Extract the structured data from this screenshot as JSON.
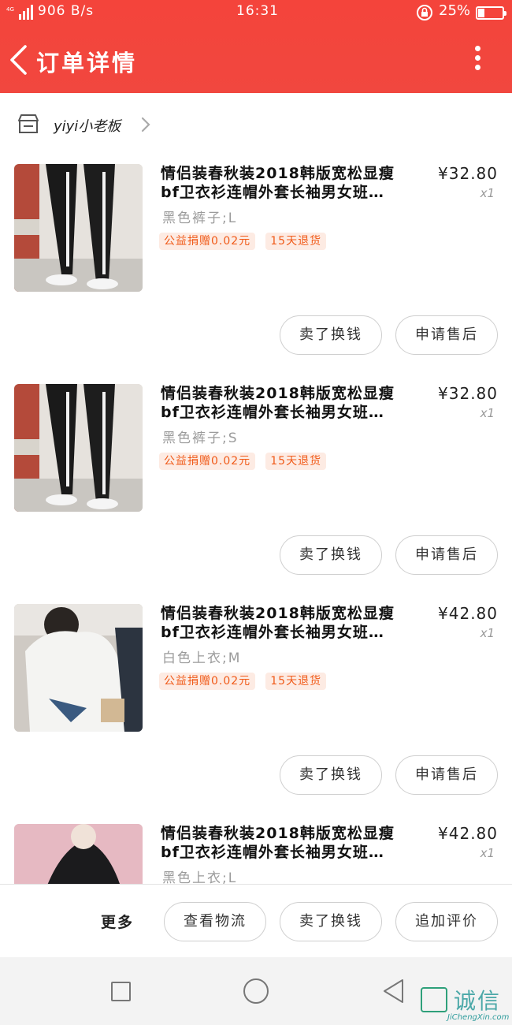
{
  "status_bar": {
    "network": "4G",
    "speed": "906 B/s",
    "time": "16:31",
    "battery_percent": "25%",
    "battery_level": 0.25
  },
  "header": {
    "title": "订单详情",
    "background": "#f4443b"
  },
  "shop": {
    "name": "yiyi小老板"
  },
  "items": [
    {
      "title_line1": "情侣装春秋装2018韩版宽松显瘦",
      "title_line2": "bf卫衣衫连帽外套长袖男女班…",
      "sku": "黑色裤子;L",
      "price": "¥32.80",
      "qty": "x1",
      "tags": [
        "公益捐赠0.02元",
        "15天退货"
      ],
      "thumb": "black-pants-photo",
      "btn_sell": "卖了换钱",
      "btn_after": "申请售后"
    },
    {
      "title_line1": "情侣装春秋装2018韩版宽松显瘦",
      "title_line2": "bf卫衣衫连帽外套长袖男女班…",
      "sku": "黑色裤子;S",
      "price": "¥32.80",
      "qty": "x1",
      "tags": [
        "公益捐赠0.02元",
        "15天退货"
      ],
      "thumb": "black-pants-photo",
      "btn_sell": "卖了换钱",
      "btn_after": "申请售后"
    },
    {
      "title_line1": "情侣装春秋装2018韩版宽松显瘦",
      "title_line2": "bf卫衣衫连帽外套长袖男女班…",
      "sku": "白色上衣;M",
      "price": "¥42.80",
      "qty": "x1",
      "tags": [
        "公益捐赠0.02元",
        "15天退货"
      ],
      "thumb": "white-hoodie-photo",
      "btn_sell": "卖了换钱",
      "btn_after": "申请售后"
    },
    {
      "title_line1": "情侣装春秋装2018韩版宽松显瘦",
      "title_line2": "bf卫衣衫连帽外套长袖男女班…",
      "sku": "黑色上衣;L",
      "price": "¥42.80",
      "qty": "x1",
      "tags": [],
      "thumb": "black-hoodie-photo",
      "btn_sell": "",
      "btn_after": ""
    }
  ],
  "action_bar": {
    "more": "更多",
    "logistics": "查看物流",
    "sell": "卖了换钱",
    "review": "追加评价"
  },
  "watermark": {
    "text": "诚信",
    "sub": "JiChengXin.com"
  }
}
